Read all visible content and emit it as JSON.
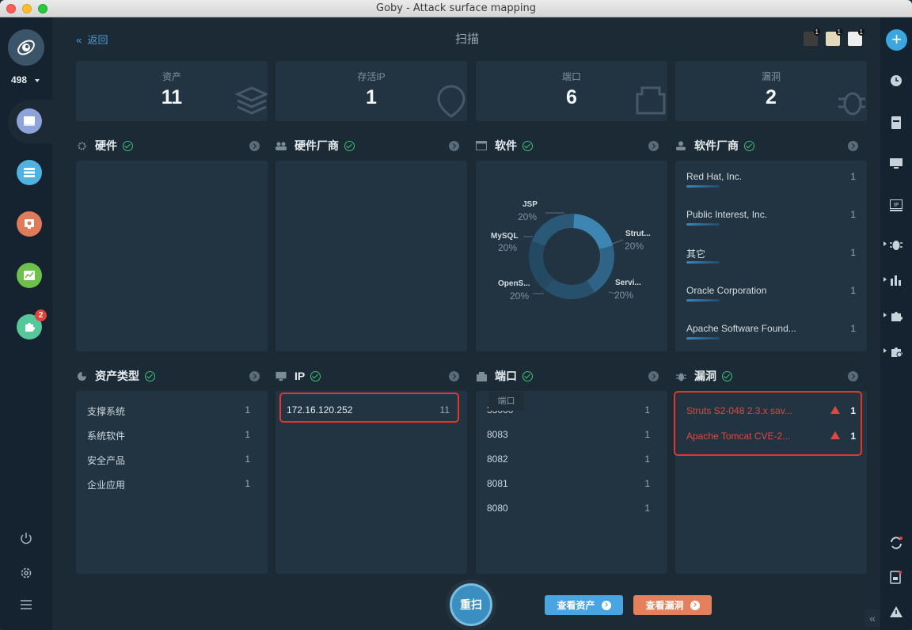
{
  "window": {
    "title": "Goby - Attack surface mapping"
  },
  "sidebar": {
    "count": "498",
    "badge": "2"
  },
  "header": {
    "back": "返回",
    "title": "扫描",
    "icon_badges": [
      "1",
      "1",
      "1"
    ]
  },
  "stats": [
    {
      "label": "资产",
      "value": "11"
    },
    {
      "label": "存活IP",
      "value": "1"
    },
    {
      "label": "端口",
      "value": "6"
    },
    {
      "label": "漏洞",
      "value": "2"
    }
  ],
  "sections": {
    "hardware": "硬件",
    "hardware_vendor": "硬件厂商",
    "software": "软件",
    "software_vendor": "软件厂商",
    "asset_type": "资产类型",
    "ip": "IP",
    "port": "端口",
    "vuln": "漏洞"
  },
  "software_chart": {
    "labels": [
      {
        "name": "JSP",
        "pct": "20%"
      },
      {
        "name": "MySQL",
        "pct": "20%"
      },
      {
        "name": "OpenS...",
        "pct": "20%"
      },
      {
        "name": "Strut...",
        "pct": "20%"
      },
      {
        "name": "Servi...",
        "pct": "20%"
      }
    ]
  },
  "chart_data": {
    "type": "pie",
    "categories": [
      "JSP",
      "Strut...",
      "Servi...",
      "OpenS...",
      "MySQL"
    ],
    "values": [
      20,
      20,
      20,
      20,
      20
    ],
    "colors": [
      "#3d86b3",
      "#2f6486",
      "#27506c",
      "#244a63",
      "#2a5877"
    ]
  },
  "software_vendors": [
    {
      "name": "Red Hat, Inc.",
      "count": "1"
    },
    {
      "name": "Public Interest, Inc.",
      "count": "1"
    },
    {
      "name": "其它",
      "count": "1"
    },
    {
      "name": "Oracle Corporation",
      "count": "1"
    },
    {
      "name": "Apache Software Found...",
      "count": "1"
    }
  ],
  "asset_types": [
    {
      "name": "支撑系统",
      "count": "1"
    },
    {
      "name": "系统软件",
      "count": "1"
    },
    {
      "name": "安全产品",
      "count": "1"
    },
    {
      "name": "企业应用",
      "count": "1"
    }
  ],
  "ips": [
    {
      "ip": "172.16.120.252",
      "count": "11"
    }
  ],
  "ports": {
    "tooltip": "端口",
    "rows": [
      {
        "port": "33060",
        "count": "1"
      },
      {
        "port": "8083",
        "count": "1"
      },
      {
        "port": "8082",
        "count": "1"
      },
      {
        "port": "8081",
        "count": "1"
      },
      {
        "port": "8080",
        "count": "1"
      }
    ]
  },
  "vulns": [
    {
      "name": "Struts S2-048 2.3.x sav...",
      "count": "1"
    },
    {
      "name": "Apache Tomcat CVE-2...",
      "count": "1"
    }
  ],
  "actions": {
    "rescan": "重扫",
    "view_assets": "查看资产",
    "view_vulns": "查看漏洞"
  },
  "colors": {
    "accent": "#3a8fc0",
    "danger": "#e2352c",
    "assets_btn": "#48a5e2",
    "vulns_btn": "#e5805c",
    "ok": "#3ec17a"
  }
}
